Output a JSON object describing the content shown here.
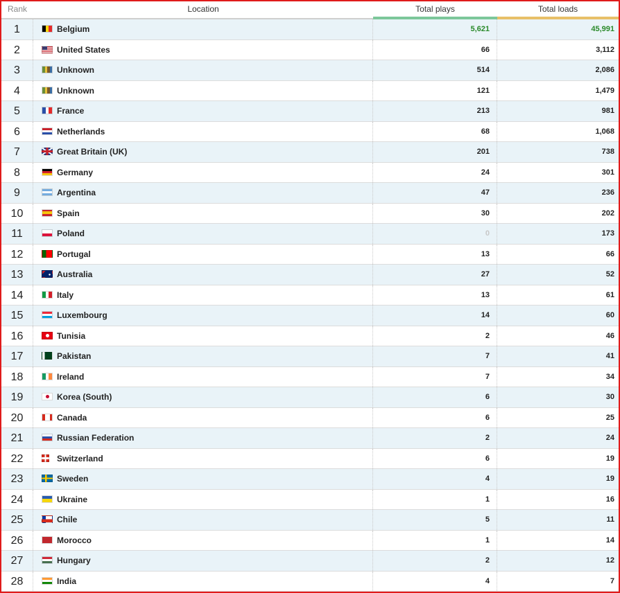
{
  "headers": {
    "rank": "Rank",
    "location": "Location",
    "plays": "Total plays",
    "loads": "Total loads"
  },
  "accent_colors": {
    "plays_bar": "#7cc79a",
    "loads_bar": "#e8c068",
    "highlight_value": "#2a8a2a",
    "frame": "#e01b1b"
  },
  "rows": [
    {
      "rank": "1",
      "location": "Belgium",
      "plays": "5,621",
      "loads": "45,991",
      "flag": "belgium-flag-icon",
      "highlight": true
    },
    {
      "rank": "2",
      "location": "United States",
      "plays": "66",
      "loads": "3,112",
      "flag": "united-states-flag-icon"
    },
    {
      "rank": "3",
      "location": "Unknown",
      "plays": "514",
      "loads": "2,086",
      "flag": "unknown-flag-icon"
    },
    {
      "rank": "4",
      "location": "Unknown",
      "plays": "121",
      "loads": "1,479",
      "flag": "unknown-flag-icon"
    },
    {
      "rank": "5",
      "location": "France",
      "plays": "213",
      "loads": "981",
      "flag": "france-flag-icon"
    },
    {
      "rank": "6",
      "location": "Netherlands",
      "plays": "68",
      "loads": "1,068",
      "flag": "netherlands-flag-icon"
    },
    {
      "rank": "7",
      "location": "Great Britain (UK)",
      "plays": "201",
      "loads": "738",
      "flag": "uk-flag-icon"
    },
    {
      "rank": "8",
      "location": "Germany",
      "plays": "24",
      "loads": "301",
      "flag": "germany-flag-icon"
    },
    {
      "rank": "9",
      "location": "Argentina",
      "plays": "47",
      "loads": "236",
      "flag": "argentina-flag-icon"
    },
    {
      "rank": "10",
      "location": "Spain",
      "plays": "30",
      "loads": "202",
      "flag": "spain-flag-icon"
    },
    {
      "rank": "11",
      "location": "Poland",
      "plays": "0",
      "loads": "173",
      "flag": "poland-flag-icon",
      "zero": true
    },
    {
      "rank": "12",
      "location": "Portugal",
      "plays": "13",
      "loads": "66",
      "flag": "portugal-flag-icon"
    },
    {
      "rank": "13",
      "location": "Australia",
      "plays": "27",
      "loads": "52",
      "flag": "australia-flag-icon"
    },
    {
      "rank": "14",
      "location": "Italy",
      "plays": "13",
      "loads": "61",
      "flag": "italy-flag-icon"
    },
    {
      "rank": "15",
      "location": "Luxembourg",
      "plays": "14",
      "loads": "60",
      "flag": "luxembourg-flag-icon"
    },
    {
      "rank": "16",
      "location": "Tunisia",
      "plays": "2",
      "loads": "46",
      "flag": "tunisia-flag-icon"
    },
    {
      "rank": "17",
      "location": "Pakistan",
      "plays": "7",
      "loads": "41",
      "flag": "pakistan-flag-icon"
    },
    {
      "rank": "18",
      "location": "Ireland",
      "plays": "7",
      "loads": "34",
      "flag": "ireland-flag-icon"
    },
    {
      "rank": "19",
      "location": "Korea (South)",
      "plays": "6",
      "loads": "30",
      "flag": "korea-flag-icon"
    },
    {
      "rank": "20",
      "location": "Canada",
      "plays": "6",
      "loads": "25",
      "flag": "canada-flag-icon"
    },
    {
      "rank": "21",
      "location": "Russian Federation",
      "plays": "2",
      "loads": "24",
      "flag": "russia-flag-icon"
    },
    {
      "rank": "22",
      "location": "Switzerland",
      "plays": "6",
      "loads": "19",
      "flag": "switzerland-flag-icon"
    },
    {
      "rank": "23",
      "location": "Sweden",
      "plays": "4",
      "loads": "19",
      "flag": "sweden-flag-icon"
    },
    {
      "rank": "24",
      "location": "Ukraine",
      "plays": "1",
      "loads": "16",
      "flag": "ukraine-flag-icon"
    },
    {
      "rank": "25",
      "location": "Chile",
      "plays": "5",
      "loads": "11",
      "flag": "chile-flag-icon"
    },
    {
      "rank": "26",
      "location": "Morocco",
      "plays": "1",
      "loads": "14",
      "flag": "morocco-flag-icon"
    },
    {
      "rank": "27",
      "location": "Hungary",
      "plays": "2",
      "loads": "12",
      "flag": "hungary-flag-icon"
    },
    {
      "rank": "28",
      "location": "India",
      "plays": "4",
      "loads": "7",
      "flag": "india-flag-icon"
    }
  ]
}
